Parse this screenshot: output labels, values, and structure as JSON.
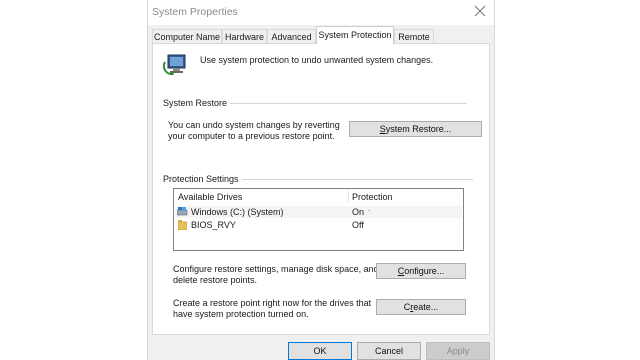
{
  "window": {
    "title": "System Properties"
  },
  "tabs": [
    {
      "label": "Computer Name",
      "active": false
    },
    {
      "label": "Hardware",
      "active": false
    },
    {
      "label": "Advanced",
      "active": false
    },
    {
      "label": "System Protection",
      "active": true
    },
    {
      "label": "Remote",
      "active": false
    }
  ],
  "intro": {
    "text": "Use system protection to undo unwanted system changes."
  },
  "system_restore": {
    "heading": "System Restore",
    "description_line1": "You can undo system changes by reverting",
    "description_line2": "your computer to a previous restore point.",
    "button_mnemonic": "S",
    "button_rest": "ystem Restore..."
  },
  "protection": {
    "heading": "Protection Settings",
    "col_drives": "Available Drives",
    "col_protection": "Protection",
    "drives": [
      {
        "name": "Windows (C:) (System)",
        "protection": "On",
        "icon": "system-drive-icon",
        "selected": true
      },
      {
        "name": "BIOS_RVY",
        "protection": "Off",
        "icon": "folder-drive-icon",
        "selected": false
      }
    ],
    "configure_text_line1": "Configure restore settings, manage disk space, and",
    "configure_text_line2": "delete restore points.",
    "configure_mnemonic": "C",
    "configure_rest": "onfigure...",
    "create_text_line1": "Create a restore point right now for the drives that",
    "create_text_line2": "have system protection turned on.",
    "create_mnemonic": "r",
    "create_prefix": "C",
    "create_rest": "eate..."
  },
  "footer": {
    "ok": "OK",
    "cancel": "Cancel",
    "apply": "Apply"
  },
  "colors": {
    "accent": "#0078d7",
    "window_bg": "#f0f0f0",
    "panel_bg": "#ffffff"
  }
}
